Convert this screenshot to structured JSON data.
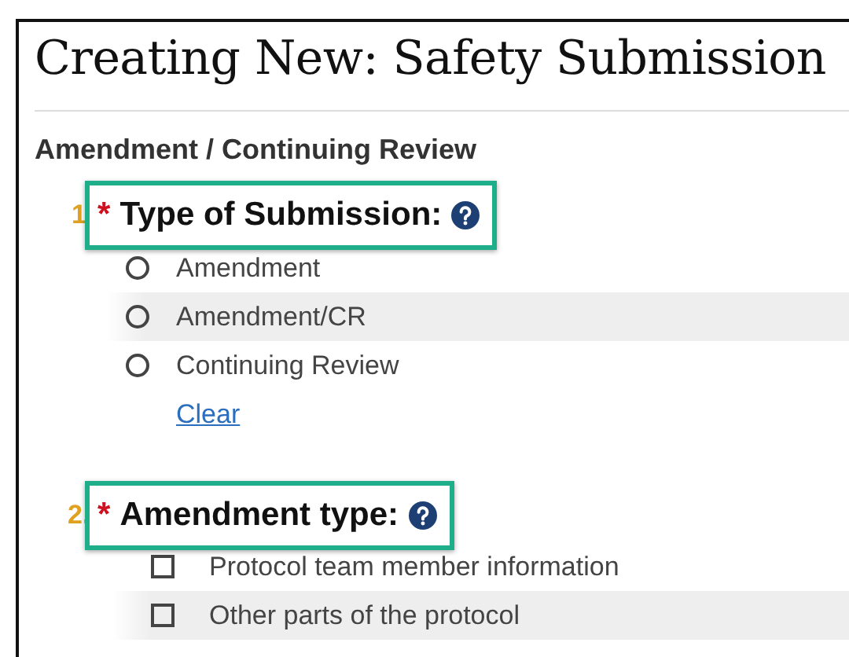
{
  "title": "Creating New: Safety Submission",
  "section": "Amendment / Continuing Review",
  "questions": [
    {
      "number": "1",
      "label": "Type of Submission:",
      "marker": "*",
      "kind": "radio",
      "options": [
        {
          "label": "Amendment",
          "selected": false
        },
        {
          "label": "Amendment/CR",
          "selected": false
        },
        {
          "label": "Continuing Review",
          "selected": false
        }
      ],
      "clear": "Clear"
    },
    {
      "number": "2.",
      "label": "Amendment type:",
      "marker": "*",
      "kind": "checkbox",
      "options": [
        {
          "label": "Protocol team member information",
          "checked": false
        },
        {
          "label": "Other parts of the protocol",
          "checked": false
        }
      ]
    }
  ]
}
